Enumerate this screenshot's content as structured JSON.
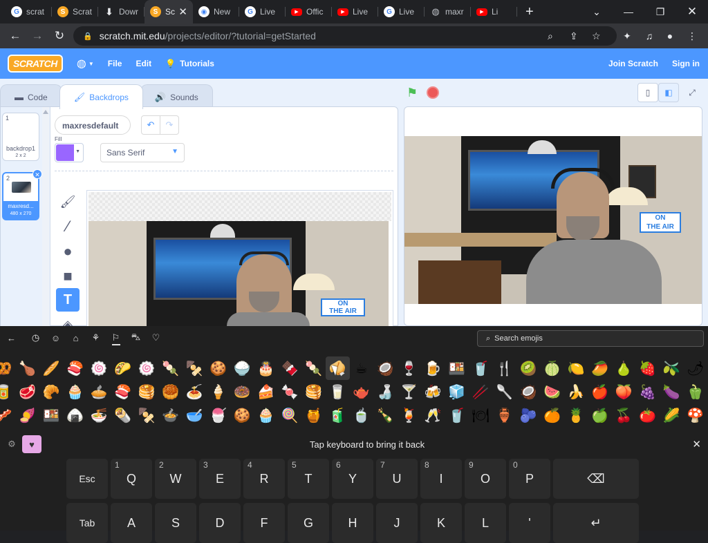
{
  "browser": {
    "tabs": [
      {
        "title": "scrat",
        "icon": "google-icon"
      },
      {
        "title": "Scrat",
        "icon": "scratch-icon"
      },
      {
        "title": "Dowr",
        "icon": "download-icon"
      },
      {
        "title": "Sc",
        "icon": "scratch-icon",
        "active": true
      },
      {
        "title": "New",
        "icon": "chrome-icon"
      },
      {
        "title": "Live",
        "icon": "google-icon"
      },
      {
        "title": "Offic",
        "icon": "youtube-icon"
      },
      {
        "title": "Live",
        "icon": "youtube-icon"
      },
      {
        "title": "Live",
        "icon": "google-icon"
      },
      {
        "title": "maxr",
        "icon": "globe-icon"
      },
      {
        "title": "Li",
        "icon": "youtube-icon"
      }
    ],
    "new_tab": "+",
    "url_host": "scratch.mit.edu",
    "url_path": "/projects/editor/?tutorial=getStarted"
  },
  "scratch": {
    "logo": "SCRATCH",
    "menu": {
      "file": "File",
      "edit": "Edit",
      "tutorials": "Tutorials",
      "join": "Join Scratch",
      "signin": "Sign in"
    },
    "tabs": {
      "code": "Code",
      "backdrops": "Backdrops",
      "sounds": "Sounds"
    },
    "backdrops": [
      {
        "num": "1",
        "name": "backdrop1",
        "size": "2 x 2"
      },
      {
        "num": "2",
        "name": "maxresd...",
        "size": "480 x 270"
      }
    ],
    "costume_name": "maxresdefault",
    "fill_label": "Fill",
    "fill_color": "#9966ff",
    "font": "Sans Serif"
  },
  "emoji_panel": {
    "search_placeholder": "Search emojis",
    "bring_back": "Tap keyboard to bring it back",
    "rows": [
      [
        "🥨",
        "🍗",
        "🥖",
        "🍣",
        "🍥",
        "🌮",
        "🍥",
        "🍡",
        "🍢",
        "🍪",
        "🍚",
        "🎂",
        "🍫",
        "🍡",
        "🥠",
        "☕",
        "🥥",
        "🍷",
        "🍺",
        "🍱",
        "🥤",
        "🍴",
        "🥝",
        "🍈",
        "🍋",
        "🥭",
        "🍐",
        "🍓",
        "🫒",
        "🌶",
        "🥝"
      ],
      [
        "🥫",
        "🥩",
        "🥐",
        "🧁",
        "🥧",
        "🍣",
        "🥞",
        "🥮",
        "🍝",
        "🍦",
        "🍩",
        "🍰",
        "🍬",
        "🥞",
        "🥛",
        "🫖",
        "🍶",
        "🍸",
        "🍻",
        "🧊",
        "🥢",
        "🥄",
        "🥥",
        "🍉",
        "🍌",
        "🍎",
        "🍑",
        "🍇",
        "🍆",
        "🫑",
        "🥬"
      ],
      [
        "🥓",
        "🍠",
        "🍱",
        "🍙",
        "🍜",
        "🌯",
        "🍢",
        "🍲",
        "🥣",
        "🍧",
        "🍪",
        "🧁",
        "🍭",
        "🍯",
        "🧃",
        "🍵",
        "🍾",
        "🍹",
        "🥂",
        "🥤",
        "🍽",
        "🏺",
        "🫐",
        "🍊",
        "🍍",
        "🍏",
        "🍒",
        "🍅",
        "🌽",
        "🍄",
        "🥦"
      ]
    ],
    "keys_row1": [
      {
        "label": "Esc"
      },
      {
        "label": "Q",
        "sub": "1"
      },
      {
        "label": "W",
        "sub": "2"
      },
      {
        "label": "E",
        "sub": "3"
      },
      {
        "label": "R",
        "sub": "4"
      },
      {
        "label": "T",
        "sub": "5"
      },
      {
        "label": "Y",
        "sub": "6"
      },
      {
        "label": "U",
        "sub": "7"
      },
      {
        "label": "I",
        "sub": "8"
      },
      {
        "label": "O",
        "sub": "9"
      },
      {
        "label": "P",
        "sub": "0"
      },
      {
        "label": "⌫"
      }
    ],
    "keys_row2": [
      {
        "label": "Tab"
      },
      {
        "label": "A"
      },
      {
        "label": "S"
      },
      {
        "label": "D"
      },
      {
        "label": "F"
      },
      {
        "label": "G"
      },
      {
        "label": "H"
      },
      {
        "label": "J"
      },
      {
        "label": "K"
      },
      {
        "label": "L"
      },
      {
        "label": "'"
      },
      {
        "label": "↵"
      }
    ]
  }
}
